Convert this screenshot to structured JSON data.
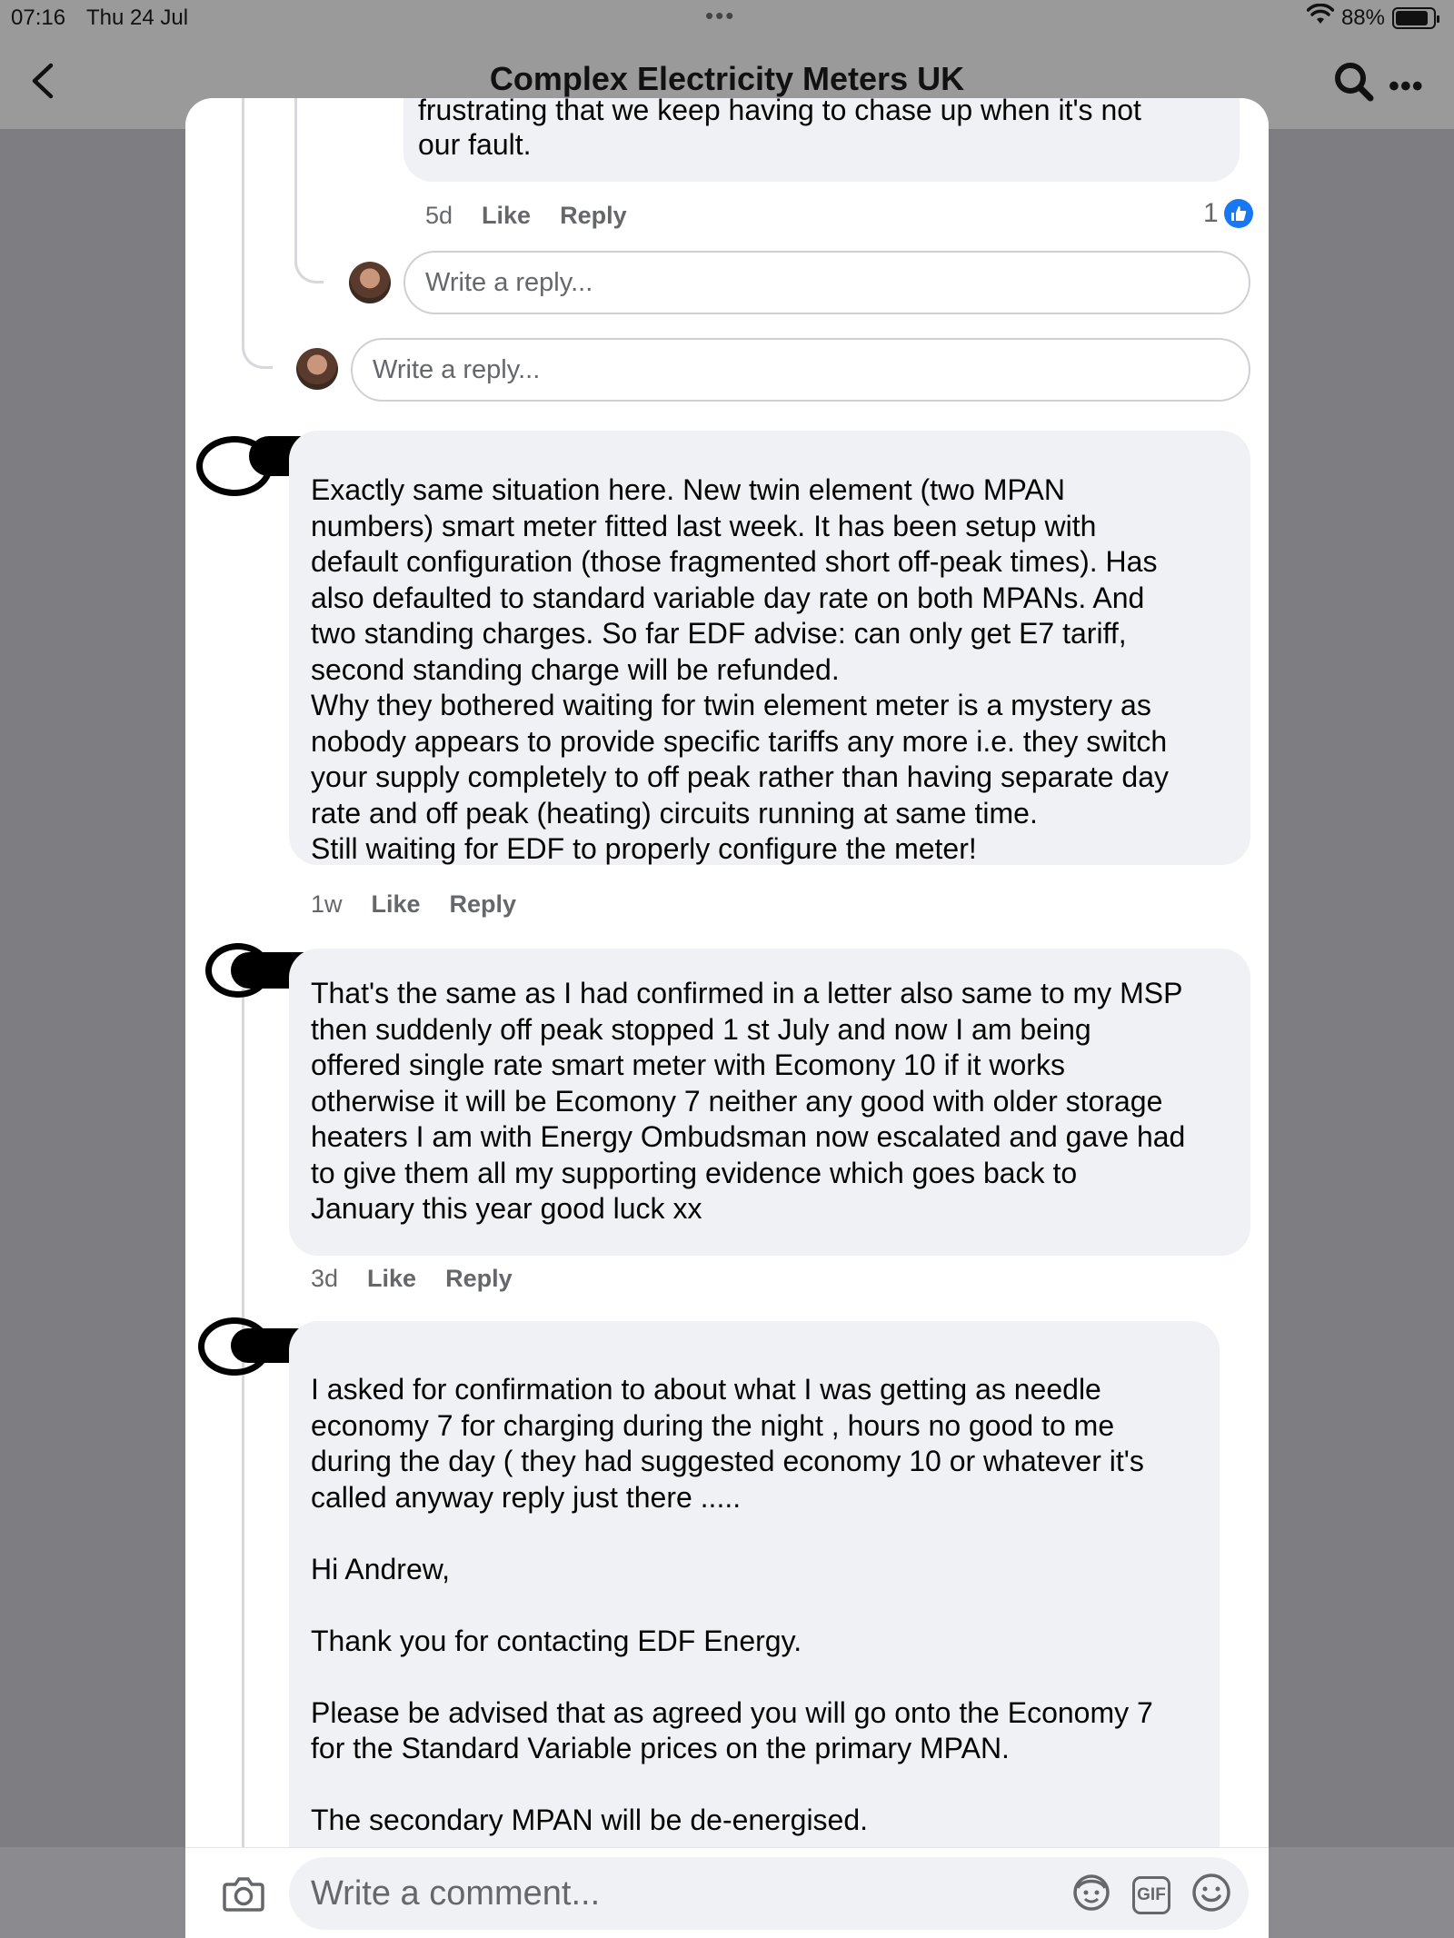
{
  "status_bar": {
    "time": "07:16",
    "date": "Thu 24 Jul",
    "dots": "•••",
    "battery": "88%",
    "battery_level": 0.88
  },
  "header": {
    "title": "Complex Electricity Meters UK"
  },
  "icons": {
    "back": "chevron-left-icon",
    "search": "search-icon",
    "more": "more-icon",
    "like": "thumbs-up-icon",
    "camera": "camera-icon",
    "avatar_sticker": "avatar-sticker-icon",
    "gif": "gif-icon",
    "emoji": "emoji-icon"
  },
  "colors": {
    "accent": "#1877f2",
    "bubble": "#f0f1f4",
    "meta_text": "#65676b",
    "backdrop": "#7d7d82"
  },
  "comments": [
    {
      "text": "our fault.",
      "partial_text": "frustrating that we keep having to chase up when it's not",
      "time": "5d",
      "like_label": "Like",
      "reply_label": "Reply",
      "reactions": "1"
    },
    {
      "text": "Exactly same situation here. New twin element (two MPAN\nnumbers) smart meter fitted last week. It has been setup with\ndefault configuration (those fragmented short off-peak times). Has\nalso defaulted to standard variable day rate on both MPANs. And\ntwo standing charges. So far EDF advise: can only get E7 tariff,\nsecond standing charge will be refunded.\nWhy they bothered waiting for twin element meter is a mystery as\nnobody appears to provide specific tariffs any more i.e. they switch\nyour supply completely to off peak rather than having separate day\nrate and off peak (heating) circuits running at same time.\nStill waiting for EDF to properly configure the meter!",
      "time": "1w",
      "like_label": "Like",
      "reply_label": "Reply"
    },
    {
      "text": "That's the same as I had confirmed in a letter also same to my MSP\nthen suddenly off peak stopped 1 st July and now I am being\noffered single rate smart meter with Ecomony 10 if it works\notherwise it will be Ecomony 7 neither any good with older storage\nheaters I am with Energy Ombudsman now escalated and gave had\nto give them all my supporting evidence which goes back to\nJanuary this year good luck xx",
      "time": "3d",
      "like_label": "Like",
      "reply_label": "Reply"
    },
    {
      "text": "I asked for confirmation to about what I was getting as needle\neconomy 7 for charging during the night , hours no good to me\nduring the day ( they had suggested economy 10 or whatever it's\ncalled anyway reply just there .....\n\nHi Andrew,\n\nThank you for contacting EDF Energy.\n\nPlease be advised that as agreed you will go onto the Economy 7\nfor the Standard Variable prices on the primary MPAN.\n\nThe secondary MPAN will be de-energised."
    }
  ],
  "reply_placeholder": "Write a reply...",
  "composer": {
    "placeholder": "Write a comment..."
  }
}
